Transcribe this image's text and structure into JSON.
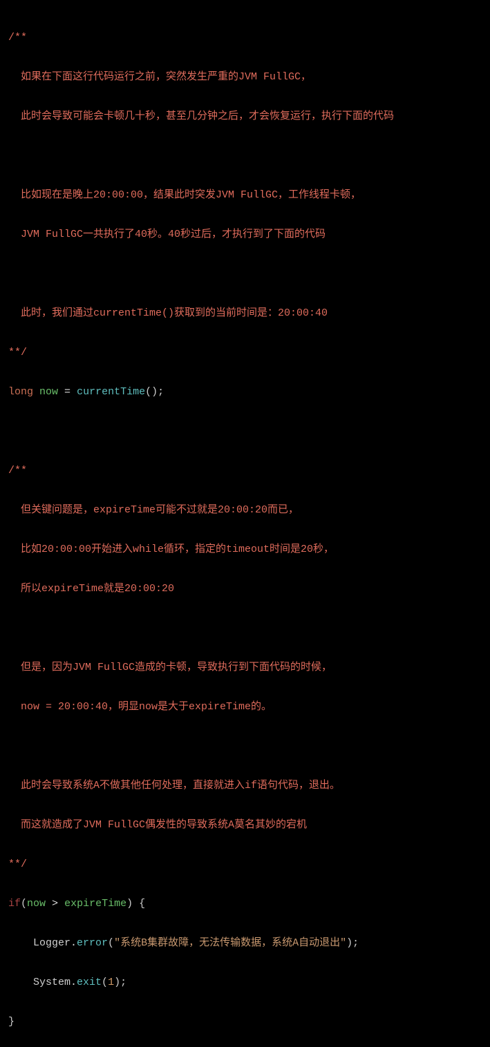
{
  "code": {
    "comment1_open": "/**",
    "comment1_line1": "如果在下面这行代码运行之前，突然发生严重的JVM FullGC，",
    "comment1_line2": "此时会导致可能会卡顿几十秒，甚至几分钟之后，才会恢复运行，执行下面的代码",
    "comment1_line3": "比如现在是晚上20:00:00，结果此时突发JVM FullGC，工作线程卡顿，",
    "comment1_line4": "JVM FullGC一共执行了40秒。40秒过后，才执行到了下面的代码",
    "comment1_line5": "此时，我们通过currentTime()获取到的当前时间是：20:00:40",
    "comment1_close": "**/",
    "stmt1_type": "long",
    "stmt1_var": "now",
    "stmt1_eq": " = ",
    "stmt1_func": "currentTime",
    "stmt1_end": "();",
    "comment2_open": "/**",
    "comment2_line1": "但关键问题是，expireTime可能不过就是20:00:20而已，",
    "comment2_line2": "比如20:00:00开始进入while循环，指定的timeout时间是20秒，",
    "comment2_line3": "所以expireTime就是20:00:20",
    "comment2_line4": "但是，因为JVM FullGC造成的卡顿，导致执行到下面代码的时候，",
    "comment2_line5": "now = 20:00:40，明显now是大于expireTime的。",
    "comment2_line6": "此时会导致系统A不做其他任何处理，直接就进入if语句代码，退出。",
    "comment2_line7": "而这就造成了JVM FullGC偶发性的导致系统A莫名其妙的宕机",
    "comment2_close": "**/",
    "if_keyword": "if",
    "if_open_paren": "(",
    "if_var1": "now",
    "if_op": " > ",
    "if_var2": "expireTime",
    "if_close": ") {",
    "logger_class": "Logger",
    "logger_dot": ".",
    "logger_method": "error",
    "logger_open": "(",
    "logger_string": "\"系统B集群故障，无法传输数据，系统A自动退出\"",
    "logger_close": ");",
    "system_class": "System",
    "system_dot": ".",
    "system_method": "exit",
    "system_open": "(",
    "system_arg": "1",
    "system_close": ");",
    "brace_close": "}"
  }
}
